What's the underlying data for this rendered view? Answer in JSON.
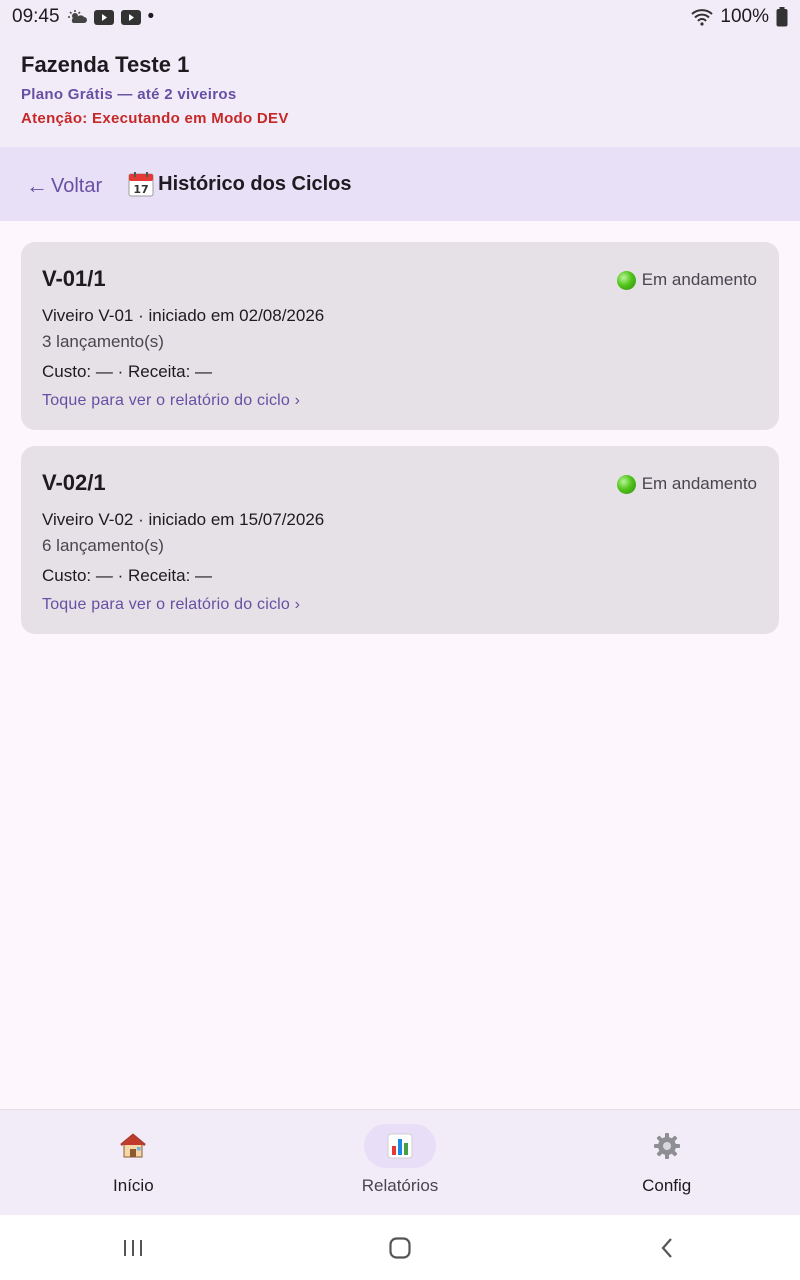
{
  "status_bar": {
    "time": "09:45",
    "dot": "•",
    "battery": "100%",
    "icons": [
      "weather-icon",
      "youtube-icon",
      "youtube-icon",
      "wifi-icon",
      "battery-icon"
    ]
  },
  "header": {
    "farm_name": "Fazenda Teste 1",
    "plan": "Plano Grátis — até 2 viveiros",
    "dev_warning": "Atenção: Executando em Modo DEV"
  },
  "nav": {
    "back_label": "Voltar",
    "back_arrow": "←",
    "title": "Histórico dos Ciclos",
    "title_icon": "calendar-icon"
  },
  "cycles": [
    {
      "code": "V-01/1",
      "status": "Em andamento",
      "info": "Viveiro V-01 · iniciado em 02/08/2026",
      "entries": "3 lançamento(s)",
      "finance": "Custo: — · Receita: —",
      "link": "Toque para ver o relatório do ciclo ›"
    },
    {
      "code": "V-02/1",
      "status": "Em andamento",
      "info": "Viveiro V-02 · iniciado em 15/07/2026",
      "entries": "6 lançamento(s)",
      "finance": "Custo: — · Receita: —",
      "link": "Toque para ver o relatório do ciclo ›"
    }
  ],
  "bottom_nav": {
    "items": [
      {
        "label": "Início",
        "icon": "house-icon",
        "active": false
      },
      {
        "label": "Relatórios",
        "icon": "bar-chart-icon",
        "active": true
      },
      {
        "label": "Config",
        "icon": "gear-icon",
        "active": false
      }
    ]
  },
  "colors": {
    "accent": "#6750a4",
    "warning": "#c62828",
    "status_ok": "#52c41a",
    "card_bg": "#e6e1e6",
    "header_bg": "#f2ecf8",
    "navbar_bg": "#e8e0f6"
  }
}
